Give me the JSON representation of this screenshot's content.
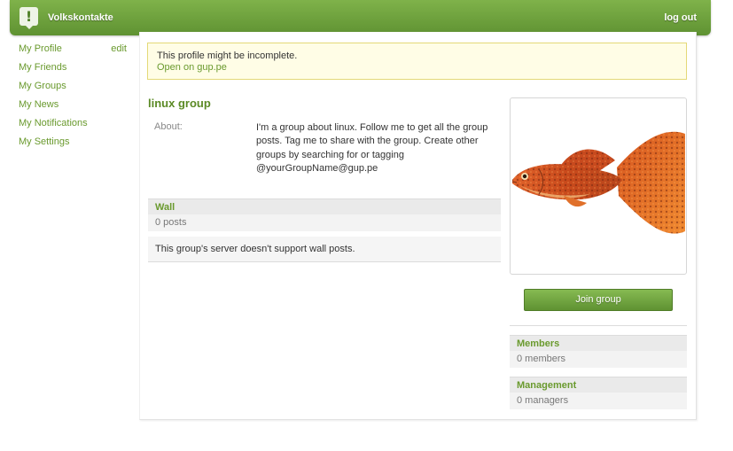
{
  "header": {
    "site_name": "Volkskontakte",
    "logout_label": "log out",
    "logo_glyph": "!"
  },
  "sidebar": {
    "edit_label": "edit",
    "items": [
      {
        "label": "My Profile"
      },
      {
        "label": "My Friends"
      },
      {
        "label": "My Groups"
      },
      {
        "label": "My News"
      },
      {
        "label": "My Notifications"
      },
      {
        "label": "My Settings"
      }
    ]
  },
  "notice": {
    "message": "This profile might be incomplete.",
    "link": "Open on gup.pe"
  },
  "group": {
    "title": "linux group",
    "about_label": "About:",
    "about_text": "I'm a group about linux. Follow me to get all the group posts. Tag me to share with the group. Create other groups by searching for or tagging @yourGroupName@gup.pe"
  },
  "wall": {
    "heading": "Wall",
    "count": "0 posts",
    "message": "This group's server doesn't support wall posts."
  },
  "right": {
    "join_label": "Join group",
    "members_heading": "Members",
    "members_count": "0 members",
    "management_heading": "Management",
    "managers_count": "0 managers"
  },
  "colors": {
    "accent": "#6a9a2e",
    "header_top": "#7fb24a",
    "header_bottom": "#5f9232",
    "notice_bg": "#fffde6",
    "notice_border": "#e4d978"
  }
}
